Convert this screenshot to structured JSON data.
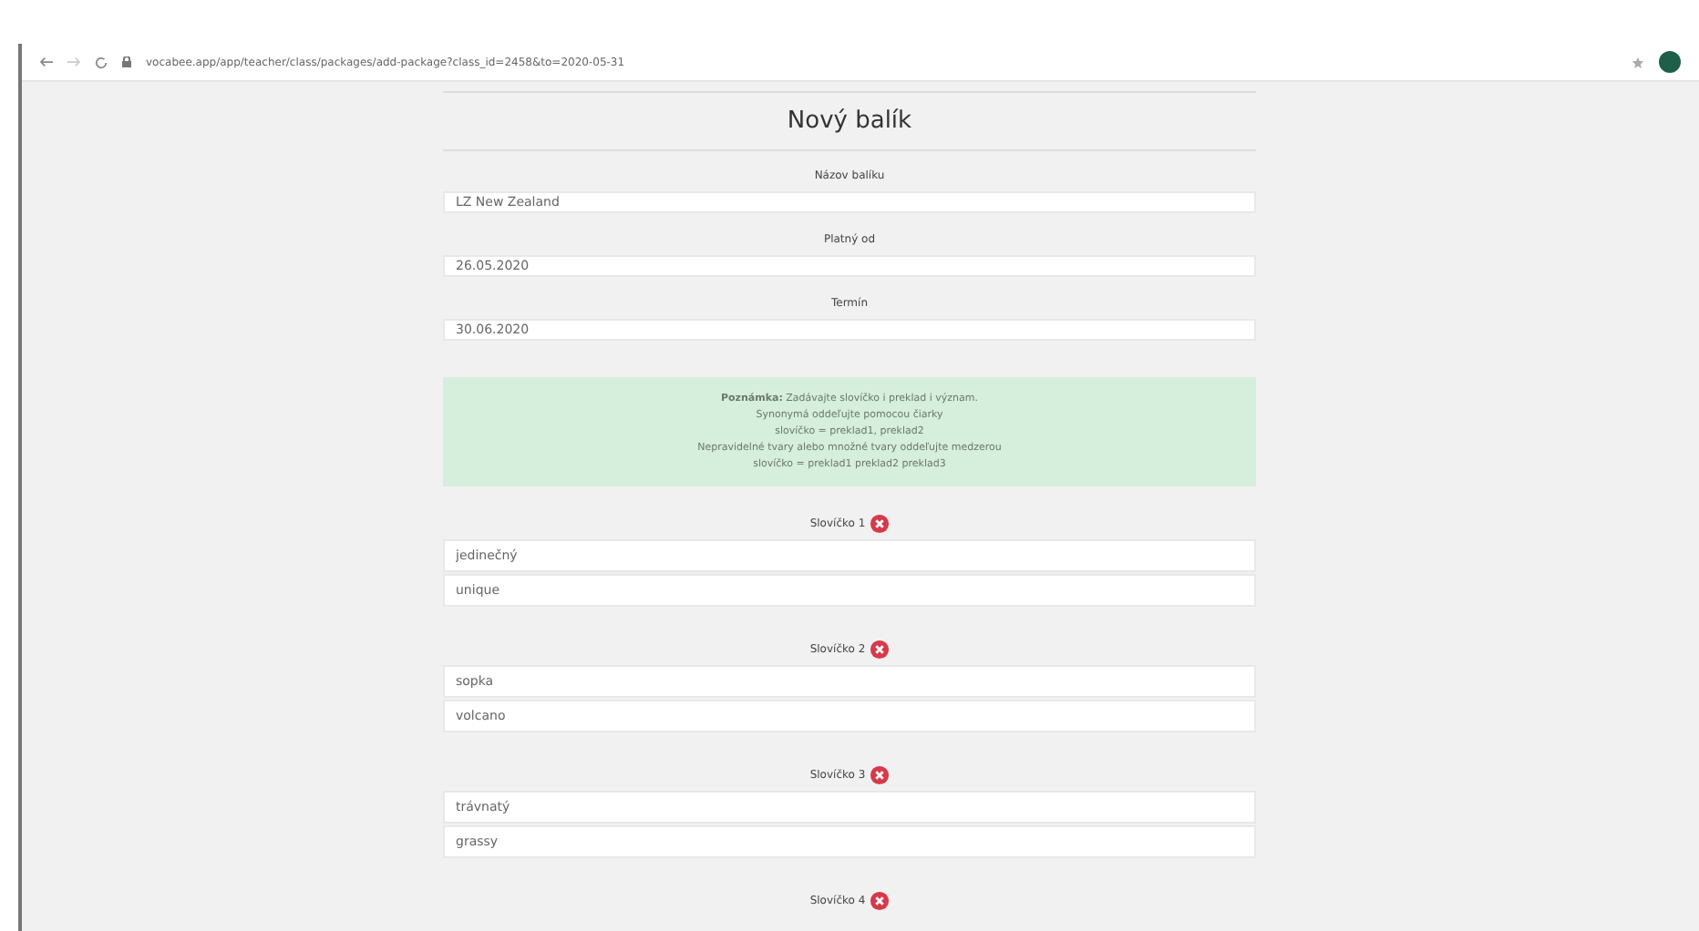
{
  "browser": {
    "url": "vocabee.app/app/teacher/class/packages/add-package?class_id=2458&to=2020-05-31"
  },
  "form": {
    "title": "Nový balík",
    "fields": [
      {
        "label": "Názov balíku",
        "value": "LZ New Zealand"
      },
      {
        "label": "Platný od",
        "value": "26.05.2020"
      },
      {
        "label": "Termín",
        "value": "30.06.2020"
      }
    ],
    "note": [
      "**Poznámka:** Zadávajte slovíčko i preklad i význam.",
      "Synonymá oddeľujte pomocou čiarky",
      "slovíčko = preklad1, preklad2",
      "Nepravidelné tvary alebo množné tvary oddeľujte medzerou",
      "slovíčko = preklad1 preklad2 preklad3"
    ],
    "words": [
      {
        "label": "Slovíčko 1",
        "word": "jedinečný",
        "translation": "unique"
      },
      {
        "label": "Slovíčko 2",
        "word": "sopka",
        "translation": "volcano"
      },
      {
        "label": "Slovíčko 3",
        "word": "trávnatý",
        "translation": "grassy"
      },
      {
        "label": "Slovíčko 4"
      }
    ]
  }
}
